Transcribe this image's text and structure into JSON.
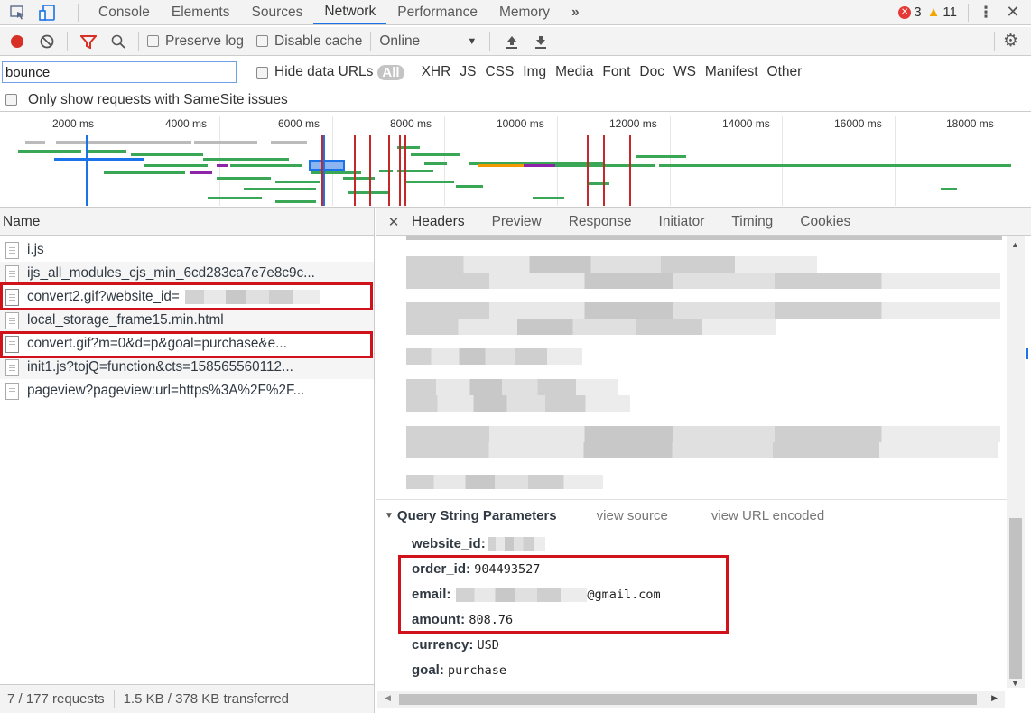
{
  "tabs": [
    "Console",
    "Elements",
    "Sources",
    "Network",
    "Performance",
    "Memory"
  ],
  "active_tab": "Network",
  "more_tabs_label": "»",
  "errors_count": "3",
  "warnings_count": "11",
  "toolbar": {
    "preserve_log": "Preserve log",
    "disable_cache": "Disable cache",
    "throttling": "Online",
    "import_icon": "upload-arrow",
    "export_icon": "download-arrow"
  },
  "filter": {
    "value": "bounce",
    "hide_data_urls": "Hide data URLs",
    "types": [
      "All",
      "XHR",
      "JS",
      "CSS",
      "Img",
      "Media",
      "Font",
      "Doc",
      "WS",
      "Manifest",
      "Other"
    ],
    "samesite": "Only show requests with SameSite issues"
  },
  "timeline_ticks": [
    "2000 ms",
    "4000 ms",
    "6000 ms",
    "8000 ms",
    "10000 ms",
    "12000 ms",
    "14000 ms",
    "16000 ms",
    "18000 ms"
  ],
  "requests_header": "Name",
  "requests": [
    "i.js",
    "ijs_all_modules_cjs_min_6cd283ca7e7e8c9c...",
    "convert2.gif?website_id=",
    "local_storage_frame15.min.html",
    "convert.gif?m=0&d=p&goal=purchase&e...",
    "init1.js?tojQ=function&cts=158565560112...",
    "pageview?pageview:url=https%3A%2F%2F..."
  ],
  "status_bar": {
    "requests": "7 / 177 requests",
    "transferred": "1.5 KB / 378 KB transferred"
  },
  "detail_tabs": [
    "Headers",
    "Preview",
    "Response",
    "Initiator",
    "Timing",
    "Cookies"
  ],
  "query": {
    "title": "Query String Parameters",
    "view_source": "view source",
    "view_url_encoded": "view URL encoded",
    "params": [
      {
        "key": "website_id:",
        "value": ""
      },
      {
        "key": "order_id:",
        "value": "904493527"
      },
      {
        "key": "email:",
        "value": "@gmail.com"
      },
      {
        "key": "amount:",
        "value": "808.76"
      },
      {
        "key": "currency:",
        "value": "USD"
      },
      {
        "key": "goal:",
        "value": "purchase"
      }
    ]
  },
  "colors": {
    "accent": "#1a73e8",
    "record": "#d93025",
    "highlight": "#d0121a",
    "filter_icon": "#d93025"
  }
}
